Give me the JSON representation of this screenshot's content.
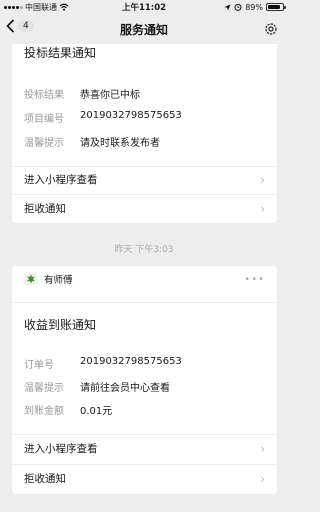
{
  "status_bar": {
    "carrier": "中国联通",
    "time": "上午11:02",
    "battery": "89%",
    "battery_level": 0.89
  },
  "nav": {
    "back_count": "4",
    "title": "服务通知"
  },
  "card1": {
    "title": "投标结果通知",
    "rows": [
      {
        "key": "投标结果",
        "value": "恭喜你已中标"
      },
      {
        "key": "项目编号",
        "value": "2019032798575653"
      },
      {
        "key": "温馨提示",
        "value": "请及时联系发布者"
      }
    ],
    "actions": [
      {
        "label": "进入小程序查看"
      },
      {
        "label": "拒收通知"
      }
    ]
  },
  "timestamp": "昨天 下午3:03",
  "card2": {
    "sender": "有师傅",
    "title": "收益到账通知",
    "rows": [
      {
        "key": "订单号",
        "value": "2019032798575653"
      },
      {
        "key": "温馨提示",
        "value": "请前往会员中心查看"
      },
      {
        "key": "到账金额",
        "value": "0.01元"
      }
    ],
    "actions": [
      {
        "label": "进入小程序查看"
      },
      {
        "label": "拒收通知"
      }
    ]
  },
  "icons": {
    "more": "•••",
    "chevron": "›"
  }
}
